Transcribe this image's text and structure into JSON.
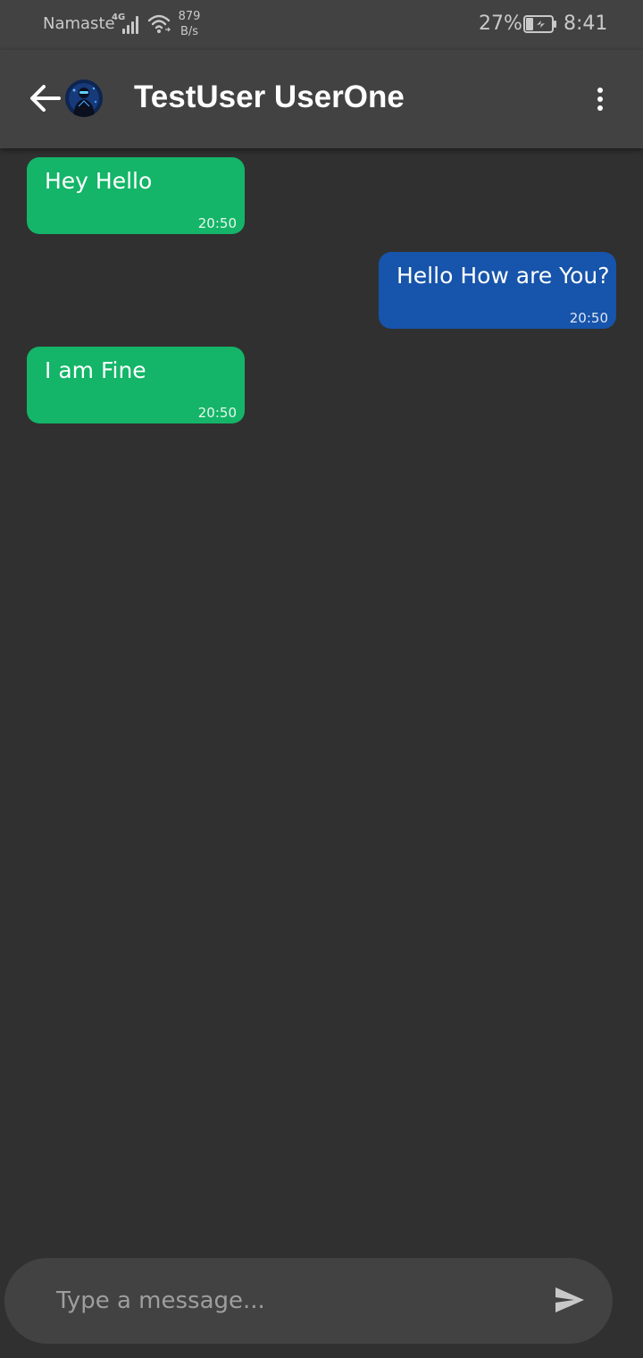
{
  "status_bar": {
    "carrier": "Namaste",
    "network_type": "4G",
    "speed_value": "879",
    "speed_unit": "B/s",
    "battery_percent": "27%",
    "time": "8:41"
  },
  "app_bar": {
    "contact_name": "TestUser UserOne"
  },
  "messages": [
    {
      "text": "Hey Hello",
      "time": "20:50",
      "direction": "incoming"
    },
    {
      "text": "Hello How are You?",
      "time": "20:50",
      "direction": "outgoing"
    },
    {
      "text": "I am Fine",
      "time": "20:50",
      "direction": "incoming"
    }
  ],
  "composer": {
    "placeholder": "Type a message..."
  },
  "colors": {
    "background": "#303030",
    "app_bar": "#424242",
    "incoming_bubble": "#14b568",
    "outgoing_bubble": "#1754ab"
  },
  "icons": {
    "back": "arrow-left-icon",
    "menu": "more-vertical-icon",
    "send": "send-icon"
  }
}
